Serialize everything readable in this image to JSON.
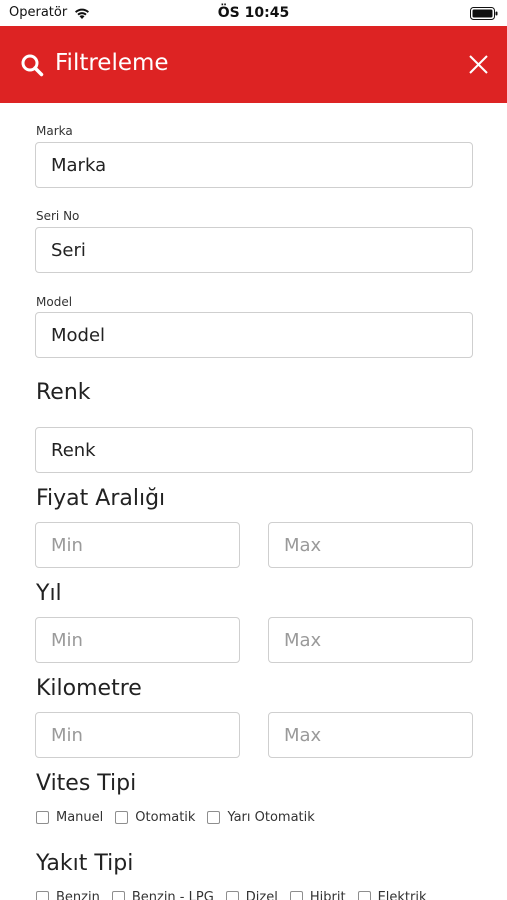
{
  "status_bar": {
    "carrier": "Operatör",
    "time": "ÖS 10:45"
  },
  "header": {
    "title": "Filtreleme",
    "accent_color": "#dd2323"
  },
  "fields": {
    "brand": {
      "label": "Marka",
      "value": "Marka"
    },
    "serial": {
      "label": "Seri No",
      "value": "Seri"
    },
    "model": {
      "label": "Model",
      "value": "Model"
    }
  },
  "color_section": {
    "title": "Renk",
    "value": "Renk"
  },
  "price_range": {
    "title": "Fiyat Aralığı",
    "min_placeholder": "Min",
    "max_placeholder": "Max"
  },
  "year": {
    "title": "Yıl",
    "min_placeholder": "Min",
    "max_placeholder": "Max"
  },
  "kilometer": {
    "title": "Kilometre",
    "min_placeholder": "Min",
    "max_placeholder": "Max"
  },
  "transmission": {
    "title": "Vites Tipi",
    "options": [
      "Manuel",
      "Otomatik",
      "Yarı Otomatik"
    ]
  },
  "fuel": {
    "title": "Yakıt Tipi",
    "options": [
      "Benzin",
      "Benzin - LPG",
      "Dizel",
      "Hibrit",
      "Elektrik"
    ]
  },
  "icons": {
    "search": "search-icon",
    "close": "close-icon",
    "wifi": "wifi-icon",
    "battery": "battery-icon"
  }
}
